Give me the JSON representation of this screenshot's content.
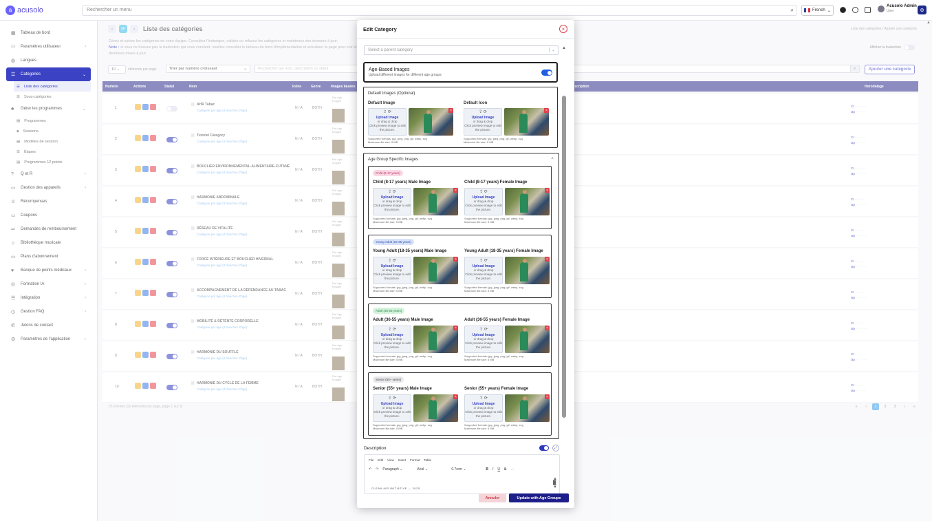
{
  "topbar": {
    "logo": "acusolo",
    "search_placeholder": "Rechercher un menu",
    "language": "French",
    "user_name": "Acusolo Admin",
    "user_role": "User"
  },
  "sidebar": {
    "items": [
      {
        "label": "Tableau de bord",
        "icon": "grid-icon"
      },
      {
        "label": "Paramètres utilisateur",
        "icon": "users-cog-icon",
        "chevron": true
      },
      {
        "label": "Langues",
        "icon": "globe-icon"
      },
      {
        "label": "Catégories",
        "icon": "layers-icon",
        "active": true,
        "chevron": true
      },
      {
        "label": "Gérer les programmes",
        "icon": "program-icon",
        "chevron": true
      },
      {
        "label": "Q et R",
        "icon": "question-icon",
        "chevron": true
      },
      {
        "label": "Gestion des appareils",
        "icon": "device-icon",
        "chevron": true
      },
      {
        "label": "Récompenses",
        "icon": "trophy-icon"
      },
      {
        "label": "Coupons",
        "icon": "ticket-icon"
      },
      {
        "label": "Demandes de remboursement",
        "icon": "refund-icon"
      },
      {
        "label": "Bibliothèque musicale",
        "icon": "music-icon"
      },
      {
        "label": "Plans d'abonnement",
        "icon": "card-icon"
      },
      {
        "label": "Banque de points médicaux",
        "icon": "heart-icon",
        "chevron": true
      },
      {
        "label": "Formation IA",
        "icon": "ai-icon",
        "chevron": true
      },
      {
        "label": "Intégration",
        "icon": "integration-icon",
        "chevron": true
      },
      {
        "label": "Gestion FAQ",
        "icon": "faq-icon",
        "chevron": true
      },
      {
        "label": "Jetons de contact",
        "icon": "phone-icon"
      },
      {
        "label": "Paramètres de l'application",
        "icon": "gear-icon",
        "chevron": true
      }
    ],
    "cat_subs": [
      "Liste des catégories",
      "Sous-catégories"
    ],
    "prog_subs": [
      "Programmes",
      "Sessions",
      "Modèles de session",
      "Étapes",
      "Programmes 12 points"
    ]
  },
  "main": {
    "title": "Liste des catégories",
    "description": "Gérez et suivez les catégories de votre équipe. Consultez l'historique, validez ou refusez les catégories et maintenez des dossiers à jour.",
    "note_label": "Note :",
    "note_text": "si vous ne trouvez pas la traduction qui vous convient, veuillez consulter le tableau de bord d'implémentation et actualiser la page pour voir les dernières mises à jour.",
    "breadcrumb": "Liste des catégories  /  Ajouter une catégorie",
    "show_translation": "Afficher la traduction",
    "per_page_value": "10",
    "per_page_label": "éléments par page",
    "sort_value": "Trier par numéro croissant",
    "search_placeholder": "Rechercher par nom, description ou statut",
    "add_button": "Ajouter une catégorie",
    "columns": [
      "Numéro",
      "Actions",
      "Statut",
      "Nom",
      "Icône",
      "Genre",
      "Images basées",
      "Description",
      "Horodatage"
    ],
    "rows": [
      {
        "num": "1",
        "name": "AHR Tabac",
        "status": false
      },
      {
        "num": "2",
        "name": "Tutoriel Category",
        "status": true
      },
      {
        "num": "3",
        "name": "BOUCLIER ENVIRONNEMENTAL-ALIMENTAIRE-CUTANÉ",
        "status": true
      },
      {
        "num": "4",
        "name": "HARMONIE ABDOMINALE",
        "status": true
      },
      {
        "num": "5",
        "name": "RÉSEAU DE VITALITÉ",
        "status": true
      },
      {
        "num": "6",
        "name": "FORCE INTÉRIEURE ET BOUCLIER HIVERNAL",
        "status": true
      },
      {
        "num": "7",
        "name": "ACCOMPAGNEMENT DE LA DÉPENDANCE AU TABAC",
        "status": true
      },
      {
        "num": "8",
        "name": "MOBILITÉ & DÉTENTE CORPORELLE",
        "status": true
      },
      {
        "num": "9",
        "name": "HARMONIE DU SOUFFLE",
        "status": true
      },
      {
        "num": "10",
        "name": "HARMONIE DU CYCLE DE LA FEMME",
        "status": true
      }
    ],
    "row_sub": "Catégorie par âge (3 tranches d'âge)",
    "row_inline": "N / A",
    "row_gender": "BOTH",
    "row_img_label": "Par Age Images",
    "footer": "25 entrées (10 éléments par page, page 1 sur 3)",
    "pages": [
      "1",
      "2",
      "3"
    ]
  },
  "modal": {
    "title": "Edit Category",
    "parent_placeholder": "Select a parent category",
    "age_title": "Age-Based Images",
    "age_sub": "Upload different images for different age groups",
    "age_enabled": true,
    "default_section": "Default Images (Optional)",
    "default_image": "Default Image",
    "default_icon": "Default Icon",
    "upload_label": "Upload Image",
    "upload_or": "or drag & drop",
    "upload_hint": "Click preview image to edit the picture.",
    "supported": "Supported formats: jpg, jpeg, png, gif, webp, svg",
    "max_size": "Maximum file size: 5 MB",
    "age_section": "Age Group Specific Images",
    "groups": [
      {
        "badge": "Child (8-17 years)",
        "male": "Child (8-17 years) Male Image",
        "female": "Child (8-17 years) Female Image",
        "color": "#f9d8e3",
        "text": "#c0306a"
      },
      {
        "badge": "Young Adult (18-35 years)",
        "male": "Young Adult (18-35 years) Male Image",
        "female": "Young Adult (18-35 years) Female Image",
        "color": "#d8e2f9",
        "text": "#2f4fb0"
      },
      {
        "badge": "Adult (36-55 years)",
        "male": "Adult (36-55 years) Male Image",
        "female": "Adult (36-55 years) Female Image",
        "color": "#d4f2dc",
        "text": "#2a8a4a"
      },
      {
        "badge": "Senior (55+ years)",
        "male": "Senior (55+ years) Male Image",
        "female": "Senior (55+ years) Female Image",
        "color": "#e8e8ec",
        "text": "#444"
      }
    ],
    "description_label": "Description",
    "editor_menus": [
      "File",
      "Edit",
      "View",
      "Insert",
      "Format",
      "Table"
    ],
    "editor_paragraph": "Paragraph",
    "editor_font": "Arial",
    "editor_size": "0.7rem",
    "editor_text": "CLEAN AIR INITIATIVE — 2025",
    "cancel": "Annuler",
    "update": "Update with Age Groups"
  }
}
